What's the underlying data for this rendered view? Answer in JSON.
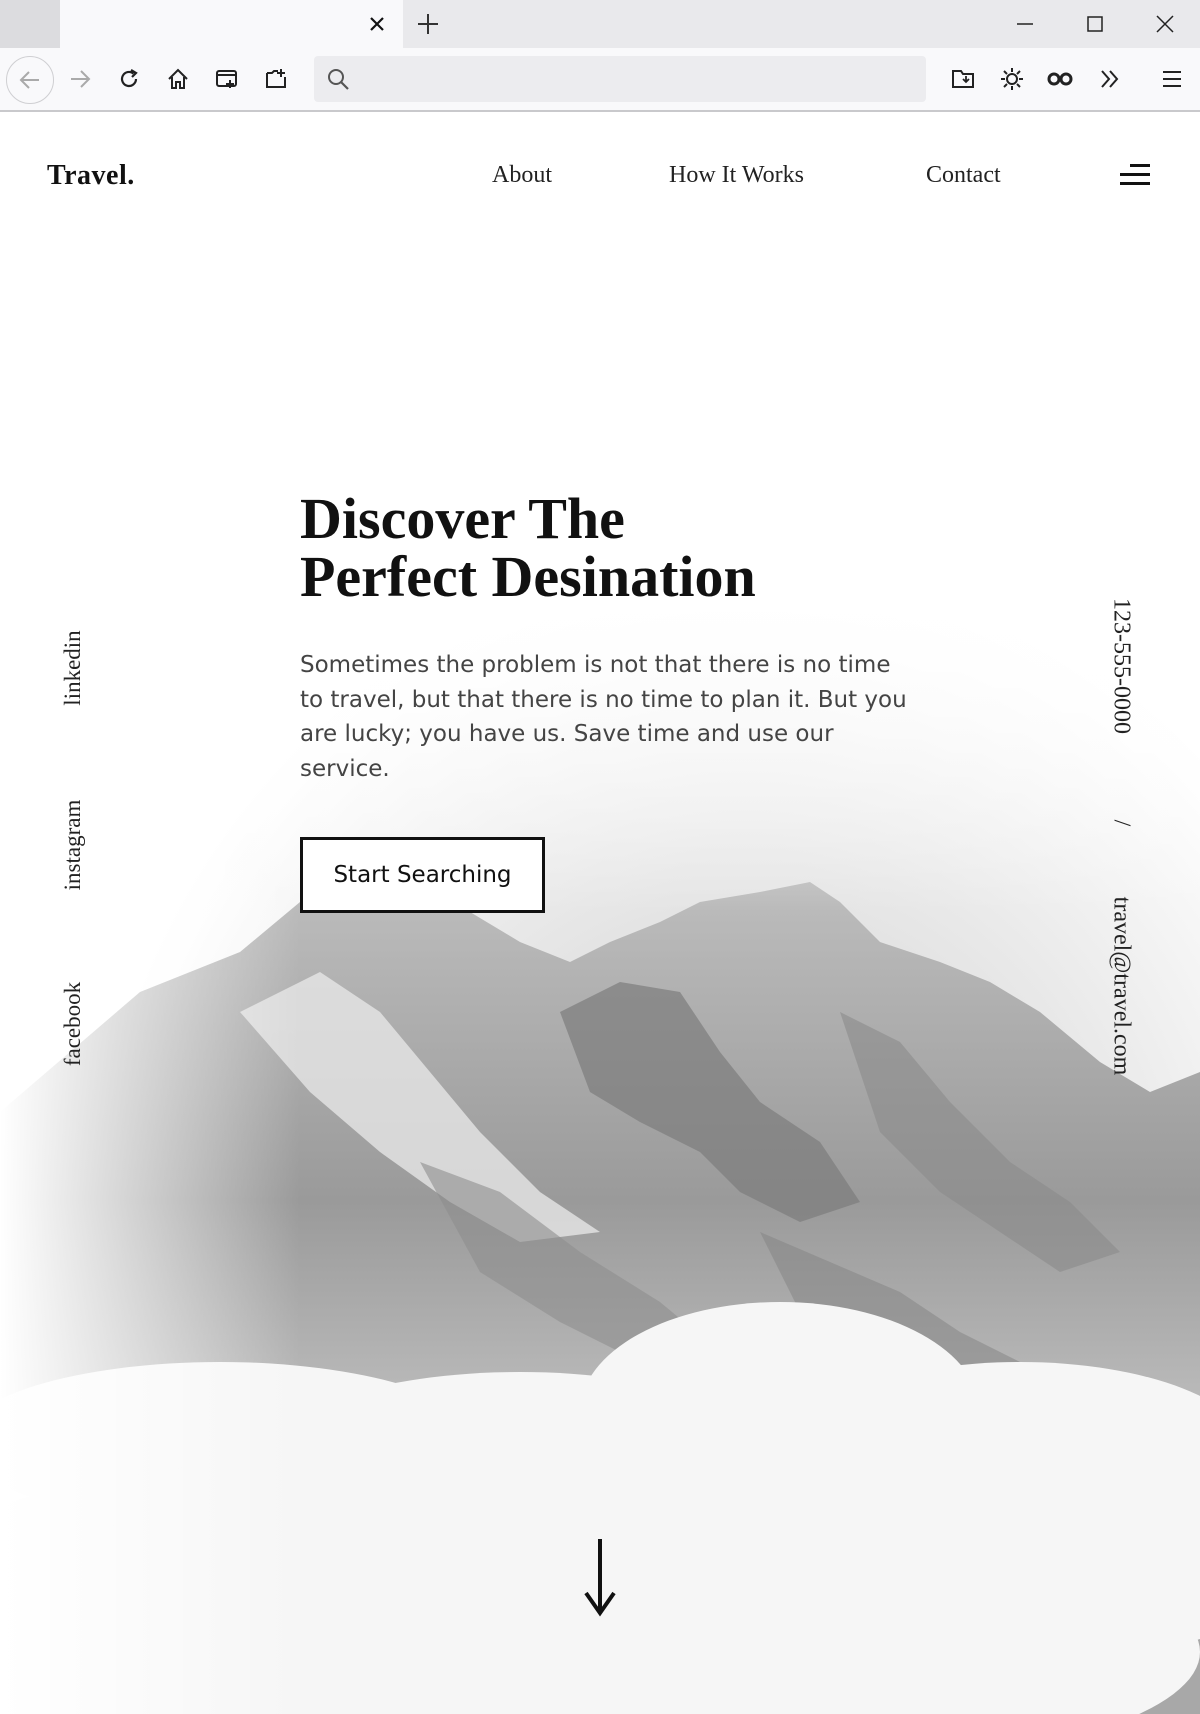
{
  "browser": {
    "tab_title": "",
    "url": "",
    "icons": {
      "tab_close": "close-icon",
      "new_tab": "plus-icon",
      "minimize": "minimize-icon",
      "maximize": "maximize-icon",
      "close_window": "close-icon",
      "back": "arrow-left-icon",
      "forward": "arrow-right-icon",
      "reload": "reload-icon",
      "home": "home-icon",
      "search": "search-icon",
      "overflow": "chevrons-right-icon",
      "menu": "hamburger-icon"
    }
  },
  "site": {
    "logo": "Travel.",
    "nav": [
      {
        "label": "About"
      },
      {
        "label": "How It Works"
      },
      {
        "label": "Contact"
      }
    ],
    "hero": {
      "title_line1": "Discover The",
      "title_line2": "Perfect Desination",
      "description": "Sometimes the problem is not that there is no time to travel, but that there is no time to plan it. But you are lucky; you have us. Save time and use our service.",
      "cta": "Start Searching"
    },
    "social": [
      "linkedin",
      "instagram",
      "facebook"
    ],
    "contact": {
      "phone": "123-555-0000",
      "separator": "/",
      "email": "travel@travel.com"
    }
  },
  "colors": {
    "text": "#111111",
    "chrome": "#e9e9ec",
    "toolbar": "#f9f9fb"
  }
}
